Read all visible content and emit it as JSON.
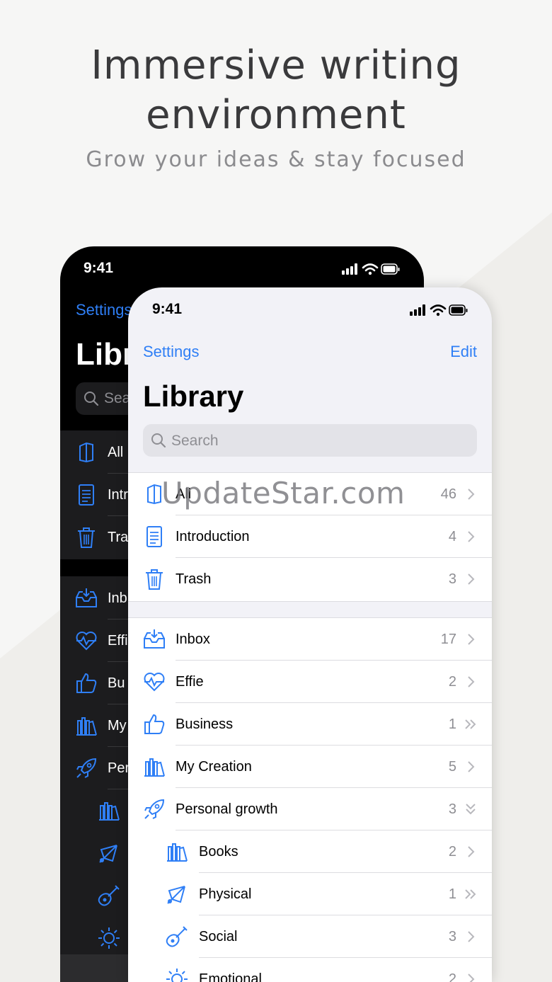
{
  "headline": {
    "line1": "Immersive writing",
    "line2": "environment",
    "subtitle": "Grow your ideas & stay focused"
  },
  "dark_phone": {
    "time": "9:41",
    "settings_label": "Settings",
    "title": "Libr",
    "search_placeholder": "Sea",
    "items": [
      {
        "label": "All",
        "icon": "book-icon"
      },
      {
        "label": "Intr",
        "icon": "document-icon"
      },
      {
        "label": "Tra",
        "icon": "trash-icon"
      },
      {
        "label": "Inb",
        "icon": "inbox-icon"
      },
      {
        "label": "Effi",
        "icon": "heartbeat-icon"
      },
      {
        "label": "Bu",
        "icon": "thumbs-up-icon"
      },
      {
        "label": "My",
        "icon": "books-icon"
      },
      {
        "label": "Per",
        "icon": "rocket-icon"
      },
      {
        "label": "",
        "icon": "books-icon"
      },
      {
        "label": "",
        "icon": "shuttlecock-icon"
      },
      {
        "label": "",
        "icon": "guitar-icon"
      },
      {
        "label": "",
        "icon": "sun-icon"
      }
    ]
  },
  "light_phone": {
    "time": "9:41",
    "settings_label": "Settings",
    "edit_label": "Edit",
    "title": "Library",
    "search_placeholder": "Search",
    "group1": [
      {
        "label": "All",
        "count": "46",
        "icon": "book-icon",
        "chevron": "single"
      },
      {
        "label": "Introduction",
        "count": "4",
        "icon": "document-icon",
        "chevron": "single"
      },
      {
        "label": "Trash",
        "count": "3",
        "icon": "trash-icon",
        "chevron": "single"
      }
    ],
    "group2": [
      {
        "label": "Inbox",
        "count": "17",
        "icon": "inbox-icon",
        "chevron": "single"
      },
      {
        "label": "Effie",
        "count": "2",
        "icon": "heartbeat-icon",
        "chevron": "single"
      },
      {
        "label": "Business",
        "count": "1",
        "icon": "thumbs-up-icon",
        "chevron": "double-right"
      },
      {
        "label": "My Creation",
        "count": "5",
        "icon": "books-icon",
        "chevron": "single"
      },
      {
        "label": "Personal growth",
        "count": "3",
        "icon": "rocket-icon",
        "chevron": "double-down"
      },
      {
        "label": "Books",
        "count": "2",
        "icon": "books-icon",
        "chevron": "single",
        "sub": true
      },
      {
        "label": "Physical",
        "count": "1",
        "icon": "shuttlecock-icon",
        "chevron": "double-right",
        "sub": true
      },
      {
        "label": "Social",
        "count": "3",
        "icon": "guitar-icon",
        "chevron": "single",
        "sub": true
      },
      {
        "label": "Emotional",
        "count": "2",
        "icon": "sun-icon",
        "chevron": "single",
        "sub": true
      }
    ]
  },
  "watermark": "UpdateStar.com",
  "colors": {
    "accent": "#2f7ff6",
    "icon_blue": "#2f7ff6"
  }
}
